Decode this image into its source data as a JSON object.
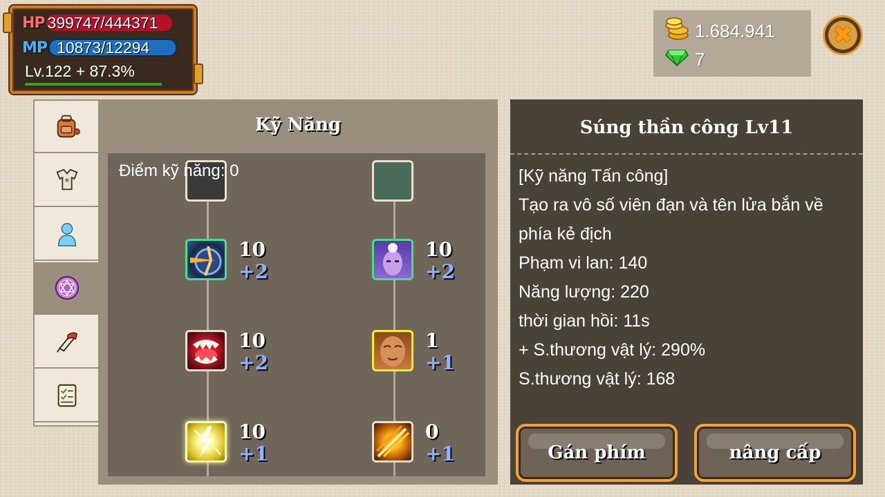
{
  "player": {
    "hp_label": "HP",
    "hp_value": "399747/444371",
    "hp_fraction": 0.8996,
    "mp_label": "MP",
    "mp_value": "10873/12294",
    "mp_fraction": 0.8844,
    "level_text": "Lv.122 + 87.3%",
    "exp_fraction": 0.873
  },
  "currency": {
    "gold": "1.684.941",
    "gold_icon": "gold-coins-icon",
    "gems": "7",
    "gem_icon": "green-gem-icon"
  },
  "close_icon": "close-x-icon",
  "tabs": [
    {
      "name": "tab-bag",
      "icon": "backpack-icon",
      "active": false
    },
    {
      "name": "tab-equipment",
      "icon": "armor-icon",
      "active": false
    },
    {
      "name": "tab-character",
      "icon": "person-icon",
      "active": false
    },
    {
      "name": "tab-skills",
      "icon": "magic-circle-icon",
      "active": true
    },
    {
      "name": "tab-quest",
      "icon": "scroll-pen-icon",
      "active": false
    },
    {
      "name": "tab-tasks",
      "icon": "checklist-icon",
      "active": false
    }
  ],
  "skills_panel": {
    "title": "Kỹ Năng",
    "points_text": "Điểm kỹ năng: 0",
    "skills": [
      {
        "col": "left",
        "level": "10",
        "plus": "+2",
        "border": "green",
        "icon": "crossbow-shot-icon"
      },
      {
        "col": "right",
        "level": "10",
        "plus": "+2",
        "border": "green",
        "icon": "mystic-face-icon"
      },
      {
        "col": "left",
        "level": "10",
        "plus": "+2",
        "border": "white",
        "icon": "fangs-icon"
      },
      {
        "col": "right",
        "level": "1",
        "plus": "+1",
        "border": "yellow",
        "icon": "monk-face-icon"
      },
      {
        "col": "left",
        "level": "10",
        "plus": "+1",
        "border": "glow",
        "icon": "lightning-icon"
      },
      {
        "col": "right",
        "level": "0",
        "plus": "+1",
        "border": "white",
        "icon": "fire-slash-icon"
      }
    ]
  },
  "detail": {
    "title": "Súng thần công Lv11",
    "lines": [
      "[Kỹ năng Tấn công]",
      "Tạo ra vô số viên đạn và tên lửa bắn về",
      "phía kẻ địch",
      "Phạm vi lan: 140",
      "Năng lượng: 220",
      "thời gian hồi: 11s",
      "+ S.thương vật lý: 290%",
      "S.thương vật lý: 168"
    ],
    "assign_label": "Gán phím",
    "upgrade_label": "nâng cấp"
  },
  "colors": {
    "hp": "#b3122a",
    "mp": "#1d6fbf",
    "exp": "#3b9a2a",
    "accent_border": "#f2a23a"
  }
}
